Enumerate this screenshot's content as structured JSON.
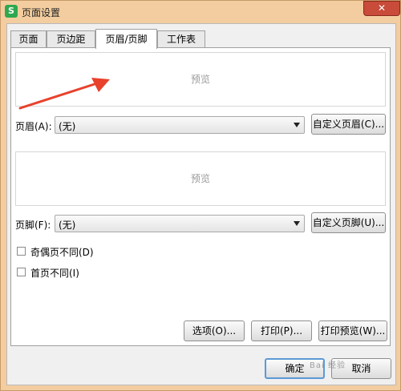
{
  "window": {
    "title": "页面设置",
    "app_icon_letter": "S",
    "close_glyph": "✕"
  },
  "tabs": [
    {
      "label": "页面"
    },
    {
      "label": "页边距"
    },
    {
      "label": "页眉/页脚",
      "active": true
    },
    {
      "label": "工作表"
    }
  ],
  "header_section": {
    "preview_text": "预览",
    "label": "页眉(A):",
    "value": "(无)",
    "custom_button": "自定义页眉(C)..."
  },
  "footer_section": {
    "preview_text": "预览",
    "label": "页脚(F):",
    "value": "(无)",
    "custom_button": "自定义页脚(U)..."
  },
  "options": {
    "odd_even_different": {
      "label": "奇偶页不同(D)",
      "checked": false
    },
    "first_page_different": {
      "label": "首页不同(I)",
      "checked": false
    }
  },
  "panel_buttons": {
    "options": "选项(O)...",
    "print": "打印(P)...",
    "print_preview": "打印预览(W)..."
  },
  "dialog_buttons": {
    "ok": "确定",
    "cancel": "取消"
  },
  "annotation": {
    "arrow_color": "#e8412c"
  },
  "watermark": {
    "text": "Bai 经验"
  },
  "colors": {
    "title_bar": "#f3cd9f",
    "default_button_border": "#5c9ad6"
  }
}
